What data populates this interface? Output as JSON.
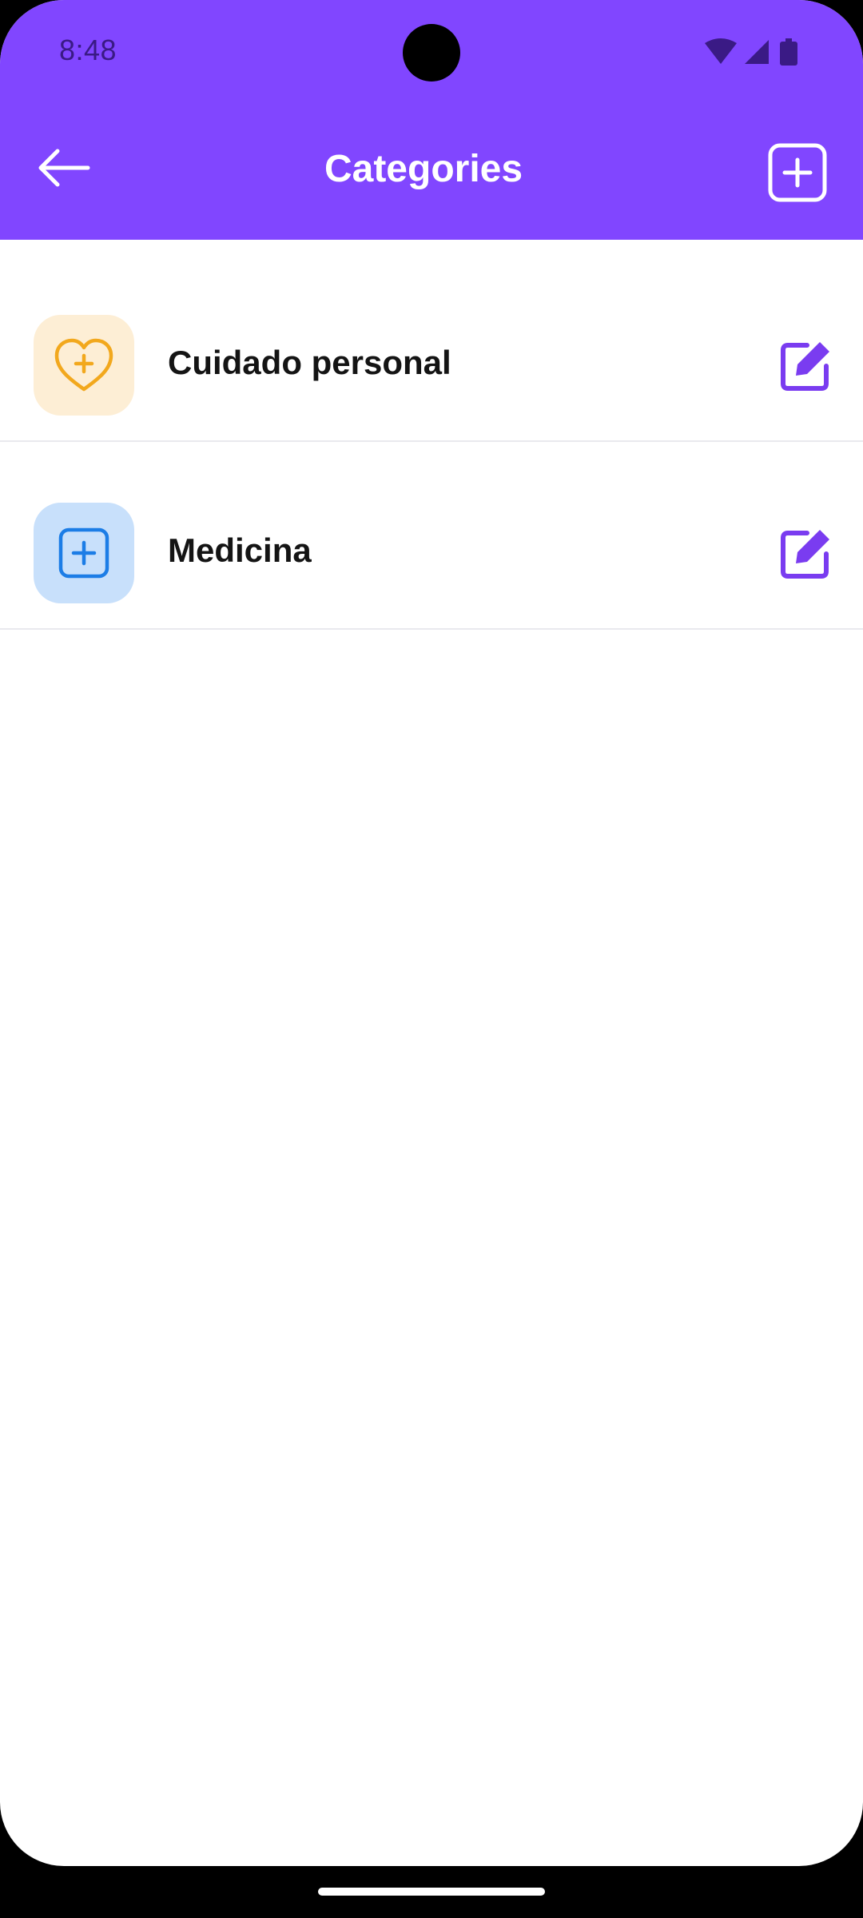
{
  "status_bar": {
    "time": "8:48",
    "icons": [
      "wifi-icon",
      "signal-icon",
      "battery-icon"
    ]
  },
  "header": {
    "title": "Categories",
    "back_icon": "arrow-left-icon",
    "add_icon": "add-square-icon"
  },
  "categories": [
    {
      "label": "Cuidado personal",
      "icon": "heart-plus-icon",
      "icon_color": "#f2a81d",
      "icon_bg": "#fdeed5",
      "edit_icon": "edit-icon"
    },
    {
      "label": "Medicina",
      "icon": "plus-square-icon",
      "icon_color": "#1c7de6",
      "icon_bg": "#c8e0fb",
      "edit_icon": "edit-icon"
    }
  ],
  "colors": {
    "accent": "#8146ff",
    "edit": "#7a3cf0",
    "divider": "#e9e9ee"
  }
}
